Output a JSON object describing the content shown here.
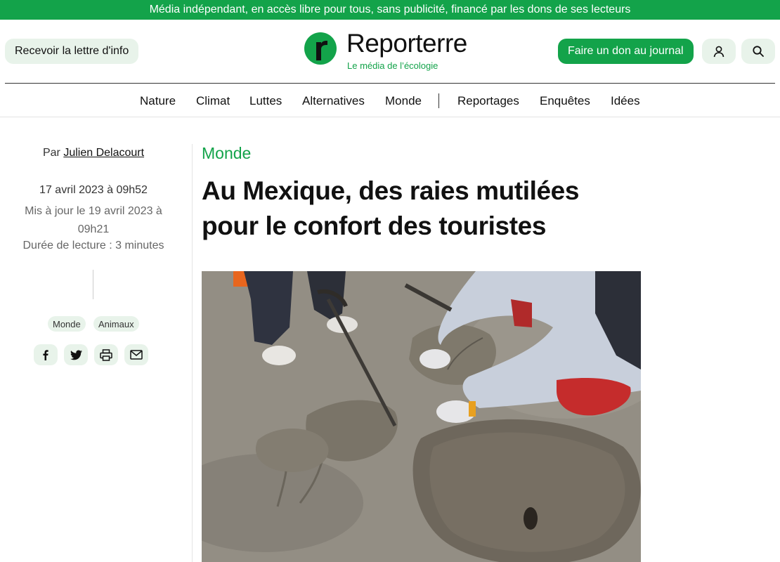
{
  "banner": {
    "text": "Média indépendant, en accès libre pour tous, sans publicité, financé par les dons de ses lecteurs"
  },
  "header": {
    "newsletter_label": "Recevoir la lettre d'info",
    "logo": {
      "name": "Reporterre",
      "tagline": "Le média de l’écologie"
    },
    "donate_label": "Faire un don au journal",
    "account_icon": "user-icon",
    "search_icon": "search-icon"
  },
  "nav": {
    "primary": [
      "Nature",
      "Climat",
      "Luttes",
      "Alternatives",
      "Monde"
    ],
    "secondary": [
      "Reportages",
      "Enquêtes",
      "Idées"
    ]
  },
  "article_meta": {
    "byline_prefix": "Par",
    "author": "Julien Delacourt",
    "published": "17 avril 2023 à 09h52",
    "updated": "Mis à jour le 19 avril 2023 à 09h21",
    "reading_time": "Durée de lecture : 3 minutes",
    "tags": [
      "Monde",
      "Animaux"
    ],
    "share_icons": [
      "facebook-icon",
      "twitter-icon",
      "print-icon",
      "mail-icon"
    ]
  },
  "article": {
    "section": "Monde",
    "title": "Au Mexique, des raies mutilées pour le confort des touristes"
  },
  "colors": {
    "brand_green": "#13a34a",
    "light_green": "#e8f3ea"
  }
}
